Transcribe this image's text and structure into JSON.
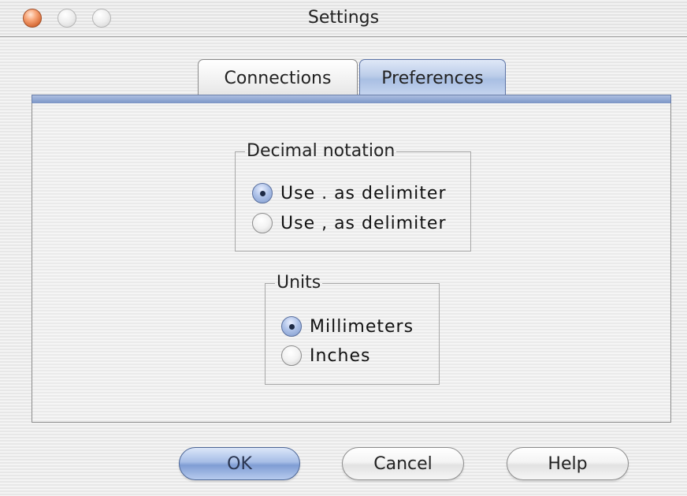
{
  "window": {
    "title": "Settings"
  },
  "tabs": [
    {
      "label": "Connections",
      "selected": false
    },
    {
      "label": "Preferences",
      "selected": true
    }
  ],
  "decimal_notation": {
    "legend": "Decimal notation",
    "options": [
      {
        "label": "Use . as delimiter",
        "selected": true
      },
      {
        "label": "Use , as delimiter",
        "selected": false
      }
    ]
  },
  "units": {
    "legend": "Units",
    "options": [
      {
        "label": "Millimeters",
        "selected": true
      },
      {
        "label": "Inches",
        "selected": false
      }
    ]
  },
  "buttons": {
    "ok": "OK",
    "cancel": "Cancel",
    "help": "Help"
  },
  "colors": {
    "accent": "#8ea6d2",
    "close_button": "#e07a45"
  }
}
